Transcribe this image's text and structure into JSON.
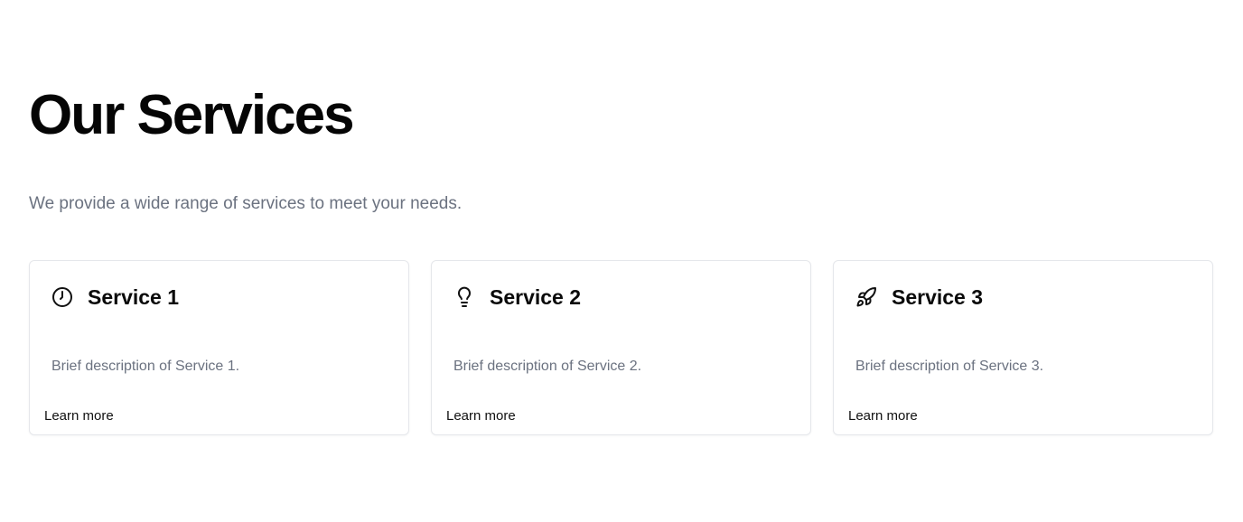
{
  "header": {
    "title": "Our Services",
    "subtitle": "We provide a wide range of services to meet your needs."
  },
  "services": [
    {
      "icon": "clock-icon",
      "title": "Service 1",
      "description": "Brief description of Service 1.",
      "link_label": "Learn more"
    },
    {
      "icon": "lightbulb-icon",
      "title": "Service 2",
      "description": "Brief description of Service 2.",
      "link_label": "Learn more"
    },
    {
      "icon": "rocket-icon",
      "title": "Service 3",
      "description": "Brief description of Service 3.",
      "link_label": "Learn more"
    }
  ],
  "colors": {
    "text": "#0a0a0a",
    "muted": "#6b7280",
    "border": "#e5e7eb",
    "background": "#ffffff"
  }
}
